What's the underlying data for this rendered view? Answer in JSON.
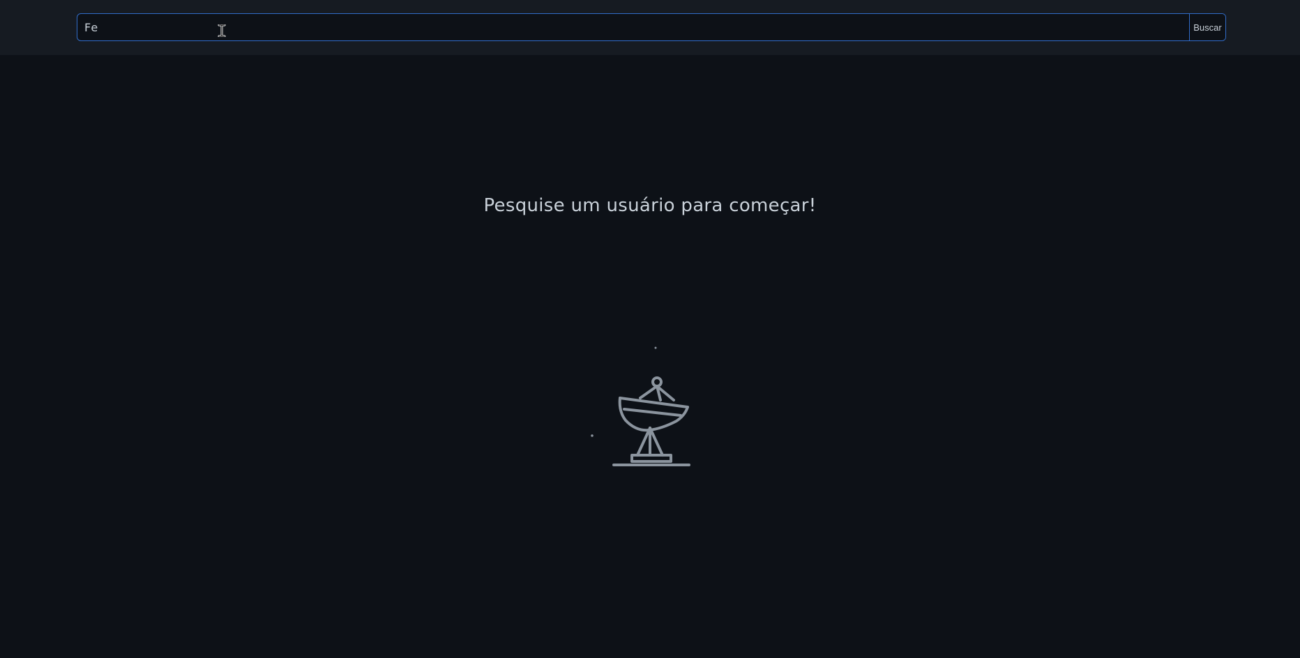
{
  "search": {
    "value": "Fe",
    "button_label": "Buscar"
  },
  "main": {
    "message": "Pesquise um usuário para começar!",
    "illustration": "satellite-dish-icon"
  },
  "colors": {
    "background": "#0d1117",
    "header": "#161b22",
    "accent_border": "#316dca",
    "text": "#c9d1d9",
    "icon": "#8b949e"
  }
}
